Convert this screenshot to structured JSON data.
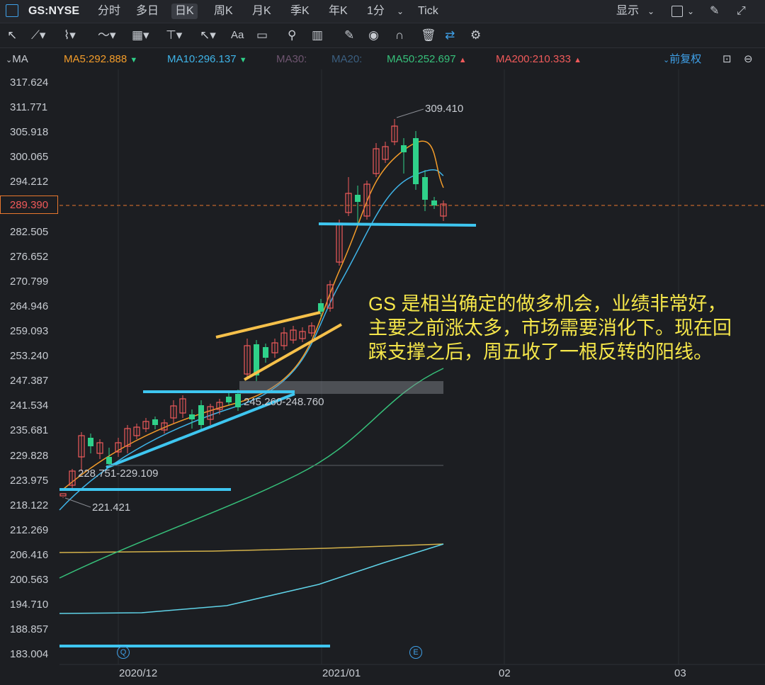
{
  "topbar": {
    "symbol": "GS:NYSE",
    "tabs": [
      "分时",
      "多日",
      "日K",
      "周K",
      "月K",
      "季K",
      "年K",
      "1分",
      "Tick"
    ],
    "active_tab": "日K",
    "display_label": "显示"
  },
  "ma_bar": {
    "label": "MA",
    "ma5": "MA5:292.888",
    "ma10": "MA10:296.137",
    "ma30": "MA30:",
    "ma20": "MA20:",
    "ma50": "MA50:252.697",
    "ma200": "MA200:210.333",
    "adjust": "前复权",
    "colors": {
      "ma5": "#f39c2a",
      "ma10": "#3fb4e8",
      "ma30": "#7a5a7a",
      "ma20": "#3b5f80",
      "ma50": "#36c07a",
      "ma200": "#f05a5a"
    }
  },
  "price_axis": [
    "317.624",
    "311.771",
    "305.918",
    "300.065",
    "294.212",
    "289.390",
    "282.505",
    "276.652",
    "270.799",
    "264.946",
    "259.093",
    "253.240",
    "247.387",
    "241.534",
    "235.681",
    "229.828",
    "223.975",
    "218.122",
    "212.269",
    "206.416",
    "200.563",
    "194.710",
    "188.857",
    "183.004"
  ],
  "current_price": "289.390",
  "date_axis": [
    "2020/12",
    "2021/01",
    "02",
    "03"
  ],
  "annotations": {
    "high": "309.410",
    "low": "221.421",
    "range1": "228.751-229.109",
    "range2": "245.260-248.760"
  },
  "markers": [
    "Q",
    "E"
  ],
  "note": "GS 是相当确定的做多机会，业绩非常好，主要之前涨太多，市场需要消化下。现在回踩支撑之后，周五收了一根反转的阳线。",
  "colors": {
    "up": "#f05a5a",
    "down": "#2fd18a",
    "bg": "#1c1e22",
    "note": "#f5e64a",
    "support": "#3ec6f0",
    "trend": "#f5c04a"
  }
}
